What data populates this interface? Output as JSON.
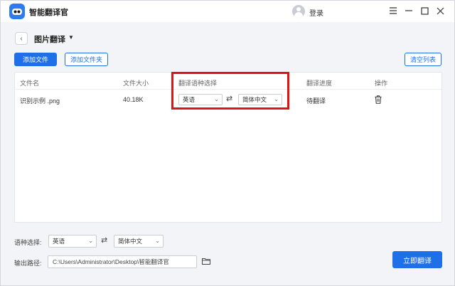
{
  "app": {
    "title": "智能翻译官",
    "login_label": "登录",
    "icons": [
      "app-logo-icon",
      "avatar-icon",
      "menu-icon",
      "minimize-icon",
      "maximize-icon",
      "close-icon"
    ]
  },
  "header": {
    "page_title": "图片翻译",
    "caret": "▼",
    "back_glyph": "‹"
  },
  "toolbar": {
    "add_file_label": "添加文件",
    "add_folder_label": "添加文件夹",
    "clear_list_label": "清空列表"
  },
  "table": {
    "columns": {
      "file_name": "文件名",
      "file_size": "文件大小",
      "language": "翻译语种选择",
      "progress": "翻译进度",
      "actions": "操作"
    },
    "rows": [
      {
        "file_name": "识别示例 .png",
        "file_size": "40.18K",
        "source_lang": "英语",
        "target_lang": "简体中文",
        "progress": "待翻译"
      }
    ]
  },
  "bottom": {
    "lang_select_label": "语种选择:",
    "source_lang": "英语",
    "target_lang": "简体中文",
    "output_label": "输出路径:",
    "output_path": "C:\\Users\\Administrator\\Desktop\\智能翻译官",
    "translate_label": "立即翻译"
  },
  "colors": {
    "accent": "#1e6fe8",
    "highlight": "#e01414",
    "background": "#f3f4f7"
  }
}
